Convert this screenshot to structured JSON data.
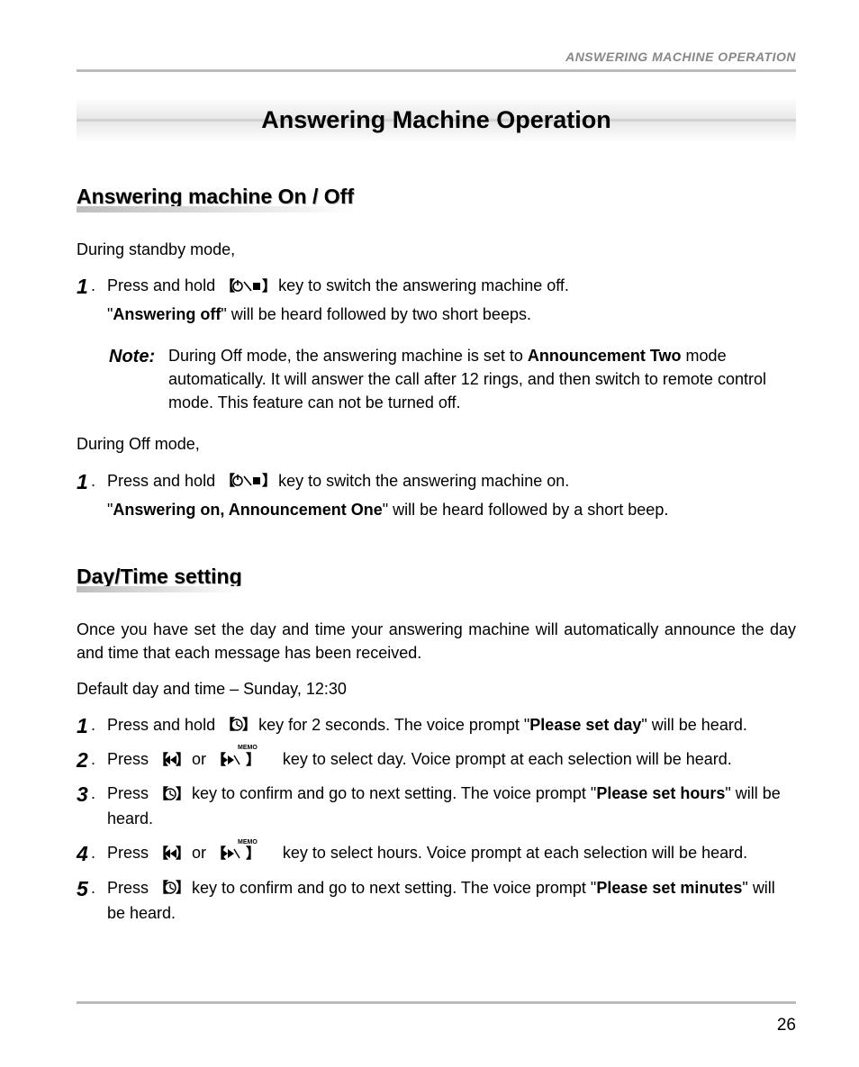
{
  "header": {
    "section_label": "ANSWERING MACHINE OPERATION"
  },
  "title": "Answering Machine Operation",
  "section1": {
    "heading": "Answering machine On / Off",
    "intro1": "During standby mode,",
    "step1_a": "Press and hold ",
    "step1_b": " key to switch the answering machine off.",
    "step1_c_pre": "\"",
    "step1_c_bold": "Answering off",
    "step1_c_post": "\" will be heard followed by two short beeps.",
    "note_label": "Note:",
    "note_a": "During Off mode, the answering machine is set to ",
    "note_bold": "Announcement Two",
    "note_b": " mode automatically. It will answer the call after 12 rings, and then switch to remote control mode. This feature can not be turned off.",
    "intro2": "During Off mode,",
    "step2_a": "Press and hold ",
    "step2_b": " key to switch the answering machine on.",
    "step2_c_pre": "\"",
    "step2_c_bold": "Answering on, Announcement One",
    "step2_c_post": "\" will be heard followed by a short beep."
  },
  "section2": {
    "heading": "Day/Time setting",
    "intro": "Once you have set the day and time your answering machine will automatically announce the day and time that each message has been received.",
    "default_line": "Default day and time – Sunday, 12:30",
    "s1_a": "Press and hold ",
    "s1_b": " key for 2 seconds. The voice prompt \"",
    "s1_bold": "Please set day",
    "s1_c": "\" will be heard.",
    "s2_a": "Press ",
    "s2_mid": " or ",
    "s2_b": " key to select day. Voice prompt at each selection will be heard.",
    "s3_a": "Press ",
    "s3_b": " key to confirm and go to next setting. The voice prompt \"",
    "s3_bold": "Please set hours",
    "s3_c": "\" will be heard.",
    "s4_a": "Press ",
    "s4_mid": " or ",
    "s4_b": " key to select hours. Voice prompt at each selection will be heard.",
    "s5_a": "Press ",
    "s5_b": " key to confirm and go to next setting. The voice prompt \"",
    "s5_bold": "Please set minutes",
    "s5_c": "\" will be heard."
  },
  "page_number": "26",
  "icons": {
    "memo_label": "MEMO"
  }
}
